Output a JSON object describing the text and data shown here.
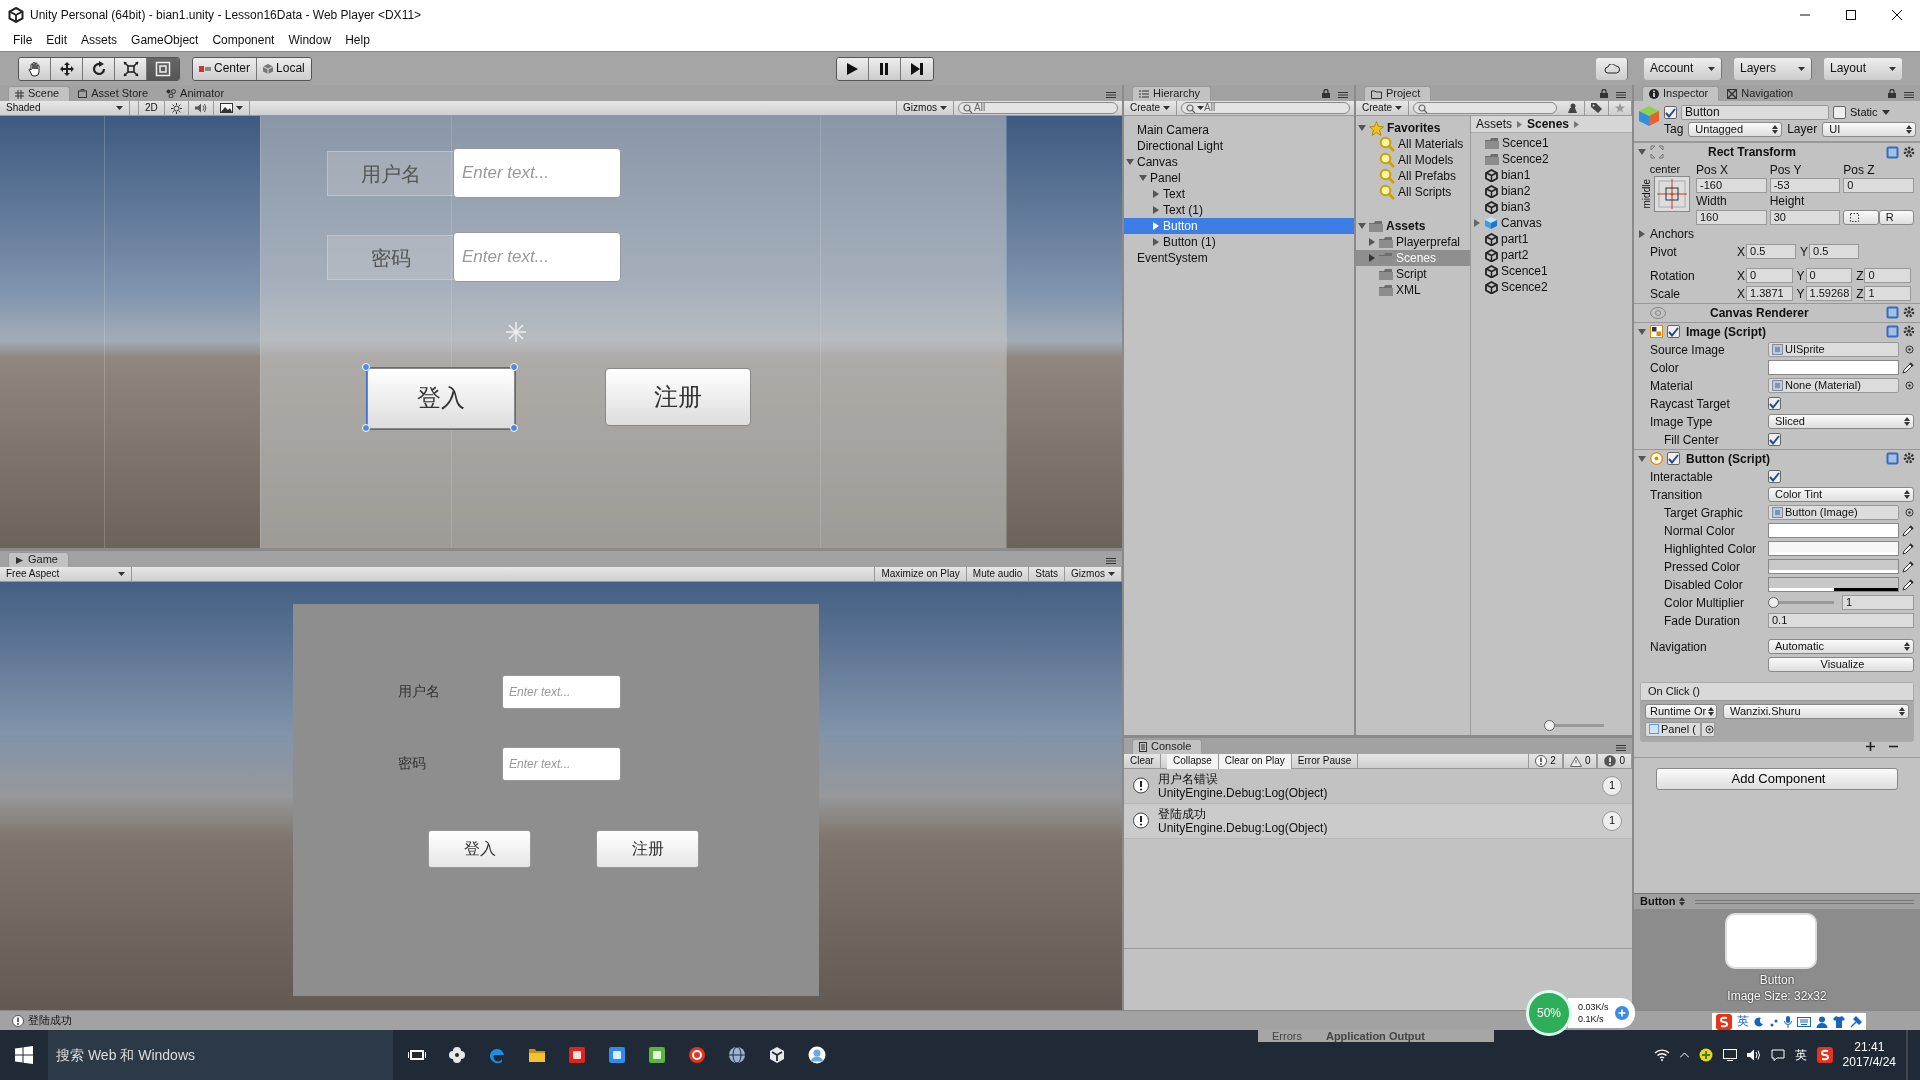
{
  "window": {
    "title": "Unity Personal (64bit) - bian1.unity - Lesson16Data - Web Player <DX11>"
  },
  "menu": [
    "File",
    "Edit",
    "Assets",
    "GameObject",
    "Component",
    "Window",
    "Help"
  ],
  "toolbar": {
    "tools": [
      {
        "kind": "hand",
        "selected": false
      },
      {
        "kind": "move",
        "selected": false
      },
      {
        "kind": "rotate",
        "selected": false
      },
      {
        "kind": "scale",
        "selected": false
      },
      {
        "kind": "rect",
        "selected": true
      }
    ],
    "pivots": [
      {
        "kind": "pivot",
        "label": "Center"
      },
      {
        "kind": "space",
        "label": "Local"
      }
    ],
    "playback": [
      {
        "kind": "play"
      },
      {
        "kind": "pause"
      },
      {
        "kind": "step"
      }
    ],
    "menus": [
      "Account",
      "Layers",
      "Layout"
    ]
  },
  "scene": {
    "tabs": [
      {
        "label": "Scene",
        "kind": "scene",
        "selected": true
      },
      {
        "label": "Asset Store",
        "kind": "store",
        "selected": false
      },
      {
        "label": "Animator",
        "kind": "animator",
        "selected": false
      }
    ],
    "shading": "Shaded",
    "mode": "2D",
    "gizmos": "Gizmos",
    "search": {
      "placeholder": "All"
    },
    "form": {
      "fields": [
        {
          "label": "用户名",
          "placeholder": "Enter text..."
        },
        {
          "label": "密码",
          "placeholder": "Enter text..."
        }
      ],
      "buttons": [
        {
          "label": "登入",
          "selected": true
        },
        {
          "label": "注册",
          "selected": false
        }
      ]
    }
  },
  "game": {
    "tab": "Game",
    "aspect": "Free Aspect",
    "options": [
      "Maximize on Play",
      "Mute audio",
      "Stats",
      "Gizmos"
    ],
    "form": {
      "fields": [
        {
          "label": "用户名",
          "placeholder": "Enter text..."
        },
        {
          "label": "密码",
          "placeholder": "Enter text..."
        }
      ],
      "buttons": [
        "登入",
        "注册"
      ]
    }
  },
  "hierarchy": {
    "title": "Hierarchy",
    "create": "Create",
    "search": {
      "placeholder": "All"
    },
    "items": [
      {
        "label": "Main Camera",
        "selected": false
      },
      {
        "label": "Directional Light",
        "selected": false
      },
      {
        "label": "Canvas",
        "selected": false,
        "expanded": true,
        "children": [
          {
            "label": "Panel",
            "selected": false,
            "expanded": true,
            "children": [
              {
                "label": "Text",
                "selected": false,
                "expanded": false
              },
              {
                "label": "Text (1)",
                "selected": false,
                "expanded": false
              },
              {
                "label": "Button",
                "selected": true,
                "expanded": false
              },
              {
                "label": "Button (1)",
                "selected": false,
                "expanded": false
              }
            ]
          }
        ]
      },
      {
        "label": "EventSystem",
        "selected": false
      }
    ]
  },
  "project": {
    "title": "Project",
    "create": "Create",
    "tree": [
      {
        "label": "Favorites",
        "kind": "favorites",
        "selected": false,
        "expanded": true,
        "children": [
          {
            "label": "All Materials",
            "kind": "search",
            "selected": false
          },
          {
            "label": "All Models",
            "kind": "search",
            "selected": false
          },
          {
            "label": "All Prefabs",
            "kind": "search",
            "selected": false
          },
          {
            "label": "All Scripts",
            "kind": "search",
            "selected": false
          }
        ]
      },
      {
        "label": "Assets",
        "kind": "root",
        "selected": false,
        "expanded": true,
        "children": [
          {
            "label": "Playerprefal",
            "kind": "folder",
            "selected": false,
            "expanded": false
          },
          {
            "label": "Scenes",
            "kind": "folder",
            "selected": true,
            "expanded": false
          },
          {
            "label": "Script",
            "kind": "folder",
            "selected": false
          },
          {
            "label": "XML",
            "kind": "folder",
            "selected": false
          }
        ]
      }
    ],
    "breadcrumb": [
      "Assets",
      "Scenes"
    ],
    "files": [
      {
        "name": "Scence1",
        "kind": "folder"
      },
      {
        "name": "Scence2",
        "kind": "folder"
      },
      {
        "name": "bian1",
        "kind": "scene"
      },
      {
        "name": "bian2",
        "kind": "scene"
      },
      {
        "name": "bian3",
        "kind": "scene"
      },
      {
        "name": "Canvas",
        "kind": "prefab"
      },
      {
        "name": "part1",
        "kind": "scene"
      },
      {
        "name": "part2",
        "kind": "scene"
      },
      {
        "name": "Scence1",
        "kind": "scene"
      },
      {
        "name": "Scence2",
        "kind": "scene"
      }
    ],
    "zoom": {
      "level": 0
    }
  },
  "console": {
    "title": "Console",
    "buttons": [
      {
        "label": "Clear",
        "on": false
      },
      {
        "label": "Collapse",
        "on": true
      },
      {
        "label": "Clear on Play",
        "on": true
      },
      {
        "label": "Error Pause",
        "on": false
      }
    ],
    "counts": [
      {
        "kind": "info",
        "count": "2"
      },
      {
        "kind": "warning",
        "count": "0"
      },
      {
        "kind": "error",
        "count": "0"
      }
    ],
    "entries": [
      {
        "message": "用户名错误",
        "trace": "UnityEngine.Debug:Log(Object)",
        "count": "1"
      },
      {
        "message": "登陆成功",
        "trace": "UnityEngine.Debug:Log(Object)",
        "count": "1"
      }
    ]
  },
  "inspector": {
    "tabs": [
      {
        "label": "Inspector",
        "kind": "info",
        "selected": true
      },
      {
        "label": "Navigation",
        "kind": "nav",
        "selected": false
      }
    ],
    "object": {
      "active": true,
      "name": "Button",
      "static": false,
      "static_label": "Static",
      "tag_label": "Tag",
      "tag": "Untagged",
      "layer_label": "Layer",
      "layer": "UI"
    },
    "rect_transform": {
      "title": "Rect Transform",
      "expanded": true,
      "anchor_h": "center",
      "anchor_v": "middle",
      "columns": [
        "Pos X",
        "Pos Y",
        "Pos Z"
      ],
      "values": [
        "-160",
        "-53",
        "0"
      ],
      "size_labels": [
        "Width",
        "Height"
      ],
      "size_values": [
        "160",
        "30"
      ],
      "reset": "R",
      "anchors": {
        "label": "Anchors",
        "expanded": false
      },
      "rows": [
        {
          "label": "Pivot",
          "axes": [
            {
              "axis": "X",
              "value": "0.5"
            },
            {
              "axis": "Y",
              "value": "0.5"
            }
          ]
        },
        {
          "label": "Rotation",
          "axes": [
            {
              "axis": "X",
              "value": "0"
            },
            {
              "axis": "Y",
              "value": "0"
            },
            {
              "axis": "Z",
              "value": "0"
            }
          ]
        },
        {
          "label": "Scale",
          "axes": [
            {
              "axis": "X",
              "value": "1.3871"
            },
            {
              "axis": "Y",
              "value": "1.59268"
            },
            {
              "axis": "Z",
              "value": "1"
            }
          ]
        }
      ]
    },
    "components": [
      {
        "title": "Canvas Renderer",
        "kind": "renderer"
      },
      {
        "title": "Image (Script)",
        "kind": "image",
        "expanded": true,
        "enabled": true,
        "rows": [
          {
            "label": "Source Image",
            "kind": "object",
            "value": "UISprite",
            "indent": false
          },
          {
            "label": "Color",
            "kind": "color",
            "color": "#ffffff",
            "level": 1,
            "indent": false
          },
          {
            "label": "Material",
            "kind": "object",
            "value": "None (Material)",
            "indent": false
          },
          {
            "label": "Raycast Target",
            "kind": "check",
            "checked": true,
            "indent": false
          },
          {
            "label": "Image Type",
            "kind": "select",
            "value": "Sliced",
            "indent": false
          },
          {
            "label": "Fill Center",
            "kind": "check",
            "checked": true,
            "indent": true
          }
        ]
      },
      {
        "title": "Button (Script)",
        "kind": "button",
        "expanded": true,
        "enabled": true,
        "rows": [
          {
            "label": "Interactable",
            "kind": "check",
            "checked": true,
            "indent": false
          },
          {
            "label": "Transition",
            "kind": "select",
            "value": "Color Tint",
            "indent": false
          },
          {
            "label": "Target Graphic",
            "kind": "object",
            "value": "Button (Image)",
            "indent": true
          },
          {
            "label": "Normal Color",
            "kind": "color",
            "color": "#ffffff",
            "level": 1,
            "indent": true
          },
          {
            "label": "Highlighted Color",
            "kind": "color",
            "color": "#f5f5f5",
            "level": 1,
            "indent": true
          },
          {
            "label": "Pressed Color",
            "kind": "color",
            "color": "#c8c8c8",
            "level": 1,
            "indent": true
          },
          {
            "label": "Disabled Color",
            "kind": "color",
            "color": "#c8c8c8",
            "level": 0.5,
            "indent": true
          },
          {
            "label": "Color Multiplier",
            "kind": "slider",
            "level": 0,
            "value": "1",
            "indent": true
          },
          {
            "label": "Fade Duration",
            "kind": "text",
            "value": "0.1",
            "indent": true
          },
          {
            "label": "Navigation",
            "kind": "select",
            "value": "Automatic",
            "indent": false
          },
          {
            "kind": "button",
            "value": "Visualize"
          }
        ],
        "event": {
          "title": "On Click ()",
          "mode": "Runtime Or",
          "function": "Wanzixi.Shuru",
          "target": "Panel ("
        }
      }
    ],
    "add_component": "Add Component",
    "preview": {
      "title": "Button",
      "caption": "Button",
      "size": "Image Size: 32x32"
    }
  },
  "status": {
    "message": "登陆成功"
  },
  "background_window": {
    "tabs": [
      "Errors",
      "Application Output"
    ]
  },
  "net_monitor": {
    "percent": "50%",
    "up": "0.03K/s",
    "down": "0.1K/s"
  },
  "ime": {
    "lang": "英"
  },
  "taskbar": {
    "search": "搜索 Web 和 Windows",
    "apps": [
      {
        "kind": "taskview",
        "color": "#ffffff"
      },
      {
        "kind": "pinwheel",
        "color": "#e8e8e8"
      },
      {
        "kind": "edge",
        "color": "#1e8fe0"
      },
      {
        "kind": "explorer",
        "color": "#f2c230"
      },
      {
        "kind": "tile",
        "color": "#e2231a"
      },
      {
        "kind": "tile",
        "color": "#2d8cf0"
      },
      {
        "kind": "tile",
        "color": "#5db33b"
      },
      {
        "kind": "ring",
        "color": "#e8331c"
      },
      {
        "kind": "globe",
        "color": "#9db3d6"
      },
      {
        "kind": "unity",
        "color": "#e8e8e8"
      },
      {
        "kind": "avatar",
        "color": "#6aa9dc"
      }
    ],
    "lang": "英",
    "time": "21:41",
    "date": "2017/4/24"
  }
}
